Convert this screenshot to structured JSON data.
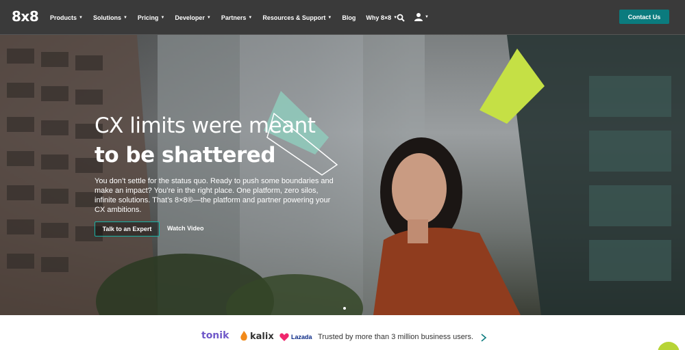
{
  "header": {
    "logo": "8x8",
    "nav": [
      {
        "label": "Products",
        "dropdown": true
      },
      {
        "label": "Solutions",
        "dropdown": true
      },
      {
        "label": "Pricing",
        "dropdown": true
      },
      {
        "label": "Developer",
        "dropdown": true
      },
      {
        "label": "Partners",
        "dropdown": true
      },
      {
        "label": "Resources & Support",
        "dropdown": true
      },
      {
        "label": "Blog",
        "dropdown": false
      },
      {
        "label": "Why 8×8",
        "dropdown": true
      }
    ],
    "search_icon": "search-icon",
    "user_icon": "user-icon",
    "contact_label": "Contact Us",
    "colors": {
      "nav_bg": "#3a3a3a",
      "accent": "#0b7b7e"
    }
  },
  "hero": {
    "title_line1": "CX limits were meant",
    "title_line2": "to be shattered",
    "body": "You don’t settle for the status quo. Ready to push some boundaries and make an impact? You’re in the right place. One platform, zero silos, infinite solutions. That’s 8×8®—the platform and partner powering your CX ambitions.",
    "cta_primary": "Talk to an Expert",
    "cta_secondary": "Watch Video",
    "colors": {
      "lime_shape": "#c5e045",
      "mint_shape": "#8fd2c0",
      "button_border": "#19b3a6"
    }
  },
  "trust": {
    "logos": [
      "tonik",
      "kalix",
      "Lazada"
    ],
    "text": "Trusted by more than 3 million business users.",
    "arrow_icon": "chevron-right-icon",
    "chat_icon": "chat-icon"
  }
}
